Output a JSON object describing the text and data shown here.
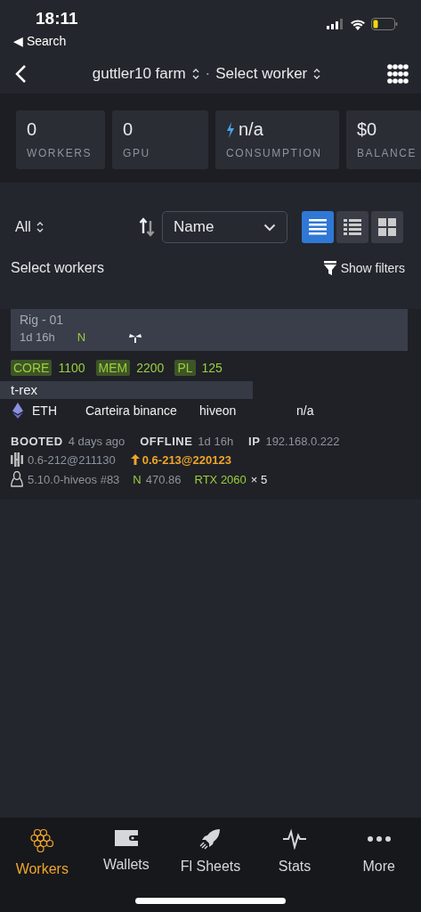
{
  "status_bar": {
    "time": "18:11",
    "back_label": "◀ Search"
  },
  "nav": {
    "farm": "guttler10 farm",
    "separator": "·",
    "worker": "Select worker"
  },
  "stats": [
    {
      "kind": "plain",
      "value": "0",
      "label": "WORKERS"
    },
    {
      "kind": "plain",
      "value": "0",
      "label": "GPU"
    },
    {
      "kind": "power",
      "value": "n/a",
      "label": "CONSUMPTION"
    },
    {
      "kind": "plain",
      "value": "$0",
      "label": "BALANCE"
    }
  ],
  "toolbar": {
    "filter": "All",
    "sort": "Name",
    "views": [
      {
        "kind": "list",
        "selected": true
      },
      {
        "kind": "detail",
        "selected": false
      },
      {
        "kind": "grid",
        "selected": false
      }
    ]
  },
  "select_label": "Select workers",
  "show_filters": "Show filters",
  "worker": {
    "name": "Rig - 01",
    "uptime": "1d 16h",
    "badge": "N",
    "tags": [
      {
        "label": "CORE",
        "value": "1100"
      },
      {
        "label": "MEM",
        "value": "2200"
      },
      {
        "label": "PL",
        "value": "125"
      }
    ],
    "miner": "t-rex",
    "coin": "ETH",
    "wallet": "Carteira binance",
    "pool": "hiveon",
    "hashrate": "n/a",
    "facts": [
      {
        "label": "BOOTED",
        "value": "4 days ago"
      },
      {
        "label": "OFFLINE",
        "value": "1d 16h"
      },
      {
        "label": "IP",
        "value": "192.168.0.222"
      }
    ],
    "version": "0.6-212@211130",
    "update_version": "0.6-213@220123",
    "kernel": "5.10.0-hiveos #83",
    "driver_label": "N",
    "driver": "470.86",
    "gpu": "RTX 2060",
    "gpu_count": "× 5"
  },
  "tabs": [
    {
      "kind": "workers",
      "label": "Workers",
      "selected": true
    },
    {
      "kind": "wallets",
      "label": "Wallets",
      "selected": false
    },
    {
      "kind": "sheets",
      "label": "Fl Sheets",
      "selected": false
    },
    {
      "kind": "stats",
      "label": "Stats",
      "selected": false
    },
    {
      "kind": "more",
      "label": "More",
      "selected": false
    }
  ]
}
